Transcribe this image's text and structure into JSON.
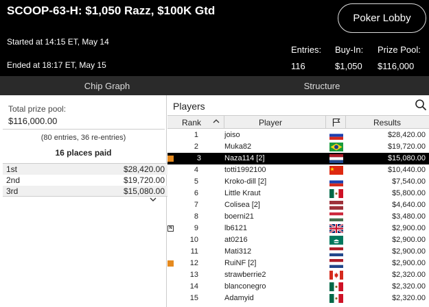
{
  "header": {
    "title": "SCOOP-63-H: $1,050 Razz, $100K Gtd",
    "lobby_button": "Poker Lobby",
    "started": "Started at 14:15 ET, May 14",
    "ended": "Ended at 18:17 ET, May 15",
    "entries_label": "Entries:",
    "entries_value": "116",
    "buyin_label": "Buy-In:",
    "buyin_value": "$1,050",
    "prizepool_label": "Prize Pool:",
    "prizepool_value": "$116,000"
  },
  "tabs": {
    "chip_graph": "Chip Graph",
    "structure": "Structure"
  },
  "left": {
    "total_label": "Total prize pool:",
    "total_value": "$116,000.00",
    "entries_note": "(80 entries, 36 re-entries)",
    "places_paid": "16 places paid",
    "prizes": [
      {
        "place": "1st",
        "amount": "$28,420.00"
      },
      {
        "place": "2nd",
        "amount": "$19,720.00"
      },
      {
        "place": "3rd",
        "amount": "$15,080.00"
      }
    ],
    "expand_icon": "chevron-down-icon"
  },
  "players": {
    "heading": "Players",
    "search_icon": "search-icon",
    "col_rank": "Rank",
    "col_player": "Player",
    "col_flag_icon": "flag-icon",
    "col_results": "Results",
    "rows": [
      {
        "rank": "1",
        "name": "joiso",
        "result": "$28,420.00",
        "flag": "ru",
        "mark": ""
      },
      {
        "rank": "2",
        "name": "Muka82",
        "result": "$19,720.00",
        "flag": "br",
        "mark": ""
      },
      {
        "rank": "3",
        "name": "Naza114 [2]",
        "result": "$15,080.00",
        "flag": "nl",
        "mark": "orange",
        "selected": true
      },
      {
        "rank": "4",
        "name": "totti1992100",
        "result": "$10,440.00",
        "flag": "cn",
        "mark": ""
      },
      {
        "rank": "5",
        "name": "Kroko-dill [2]",
        "result": "$7,540.00",
        "flag": "ru",
        "mark": ""
      },
      {
        "rank": "6",
        "name": "Little Kraut",
        "result": "$5,800.00",
        "flag": "mx",
        "mark": ""
      },
      {
        "rank": "7",
        "name": "Colisea [2]",
        "result": "$4,640.00",
        "flag": "lv",
        "mark": ""
      },
      {
        "rank": "8",
        "name": "boerni21",
        "result": "$3,480.00",
        "flag": "hu",
        "mark": ""
      },
      {
        "rank": "9",
        "name": "lb6121",
        "result": "$2,900.00",
        "flag": "gb",
        "mark": "n"
      },
      {
        "rank": "10",
        "name": "at0216",
        "result": "$2,900.00",
        "flag": "mo",
        "mark": ""
      },
      {
        "rank": "11",
        "name": "Mati312",
        "result": "$2,900.00",
        "flag": "nl",
        "mark": ""
      },
      {
        "rank": "12",
        "name": "RuiNF [2]",
        "result": "$2,900.00",
        "flag": "nl",
        "mark": "orange"
      },
      {
        "rank": "13",
        "name": "strawberrie2",
        "result": "$2,320.00",
        "flag": "ca",
        "mark": ""
      },
      {
        "rank": "14",
        "name": "blanconegro",
        "result": "$2,320.00",
        "flag": "mx",
        "mark": ""
      },
      {
        "rank": "15",
        "name": "Adamyid",
        "result": "$2,320.00",
        "flag": "mx",
        "mark": ""
      }
    ]
  },
  "colors": {
    "header_bg": "#000000",
    "tab_bg": "#2a2a2a",
    "accent_orange": "#e58a1f"
  }
}
